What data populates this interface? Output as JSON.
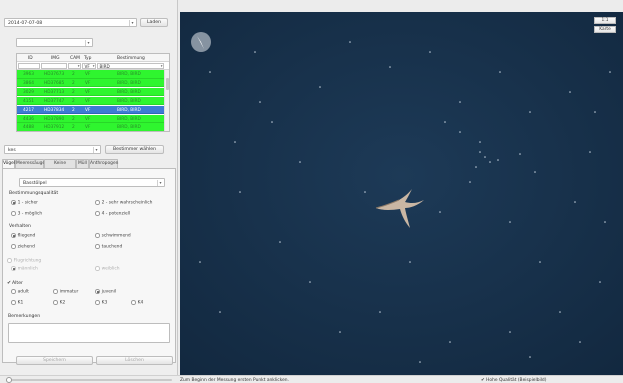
{
  "toolbar": {
    "date_value": "2014-07-07-08",
    "load_label": "Laden",
    "secondary_value": ""
  },
  "table": {
    "columns": [
      "ID",
      "IMG",
      "CAM",
      "Typ",
      "Bestimmung"
    ],
    "filter": {
      "typ": "VF",
      "bestimmung": "BIRD"
    },
    "rows": [
      {
        "id": "3963",
        "img": "HD37673",
        "cam": "2",
        "typ": "VF",
        "bestimmung": "BIRD, BIRD",
        "selected": false
      },
      {
        "id": "3864",
        "img": "HD37685",
        "cam": "2",
        "typ": "VF",
        "bestimmung": "BIRD, BIRD",
        "selected": false
      },
      {
        "id": "3029",
        "img": "HD37713",
        "cam": "2",
        "typ": "VF",
        "bestimmung": "BIRD, BIRD",
        "selected": false
      },
      {
        "id": "4151",
        "img": "HD37747",
        "cam": "2",
        "typ": "VF",
        "bestimmung": "BIRD, BIRD",
        "selected": false
      },
      {
        "id": "4217",
        "img": "HD37834",
        "cam": "2",
        "typ": "VF",
        "bestimmung": "BIRD, BIRD",
        "selected": true
      },
      {
        "id": "4436",
        "img": "HD37890",
        "cam": "2",
        "typ": "VF",
        "bestimmung": "BIRD, BIRD",
        "selected": false
      },
      {
        "id": "4488",
        "img": "HD37912",
        "cam": "2",
        "typ": "VF",
        "bestimmung": "BIRD, BIRD",
        "selected": false
      }
    ]
  },
  "identify": {
    "user_value": "kes",
    "choose_label": "Bestimmer wählen"
  },
  "tabs": [
    "Vögel",
    "Meeressäuger",
    "Keine Sichtung",
    "Müll",
    "Anthropogen"
  ],
  "form": {
    "species_value": "Basstölpel",
    "quality_heading": "Bestimmungsqualität",
    "quality_options": [
      "1 - sicher",
      "2 - sehr wahrscheinlich",
      "3 - möglich",
      "4 - potenziell"
    ],
    "behavior_heading": "Verhalten",
    "behavior_options": [
      "fliegend",
      "schwimmend",
      "ziehend",
      "tauchend"
    ],
    "direction_label": "Flugrichtung",
    "sex_options": [
      "männlich",
      "weiblich"
    ],
    "age_label": "Alter",
    "age_options": [
      "adult",
      "immatur",
      "juvenil",
      "K1",
      "K2",
      "K3",
      "K4"
    ],
    "remarks_label": "Bemerkungen",
    "save_label": "Speichern",
    "delete_label": "Löschen"
  },
  "map": {
    "zoom_label": "1:1",
    "map_label": "Karte"
  },
  "status": {
    "message": "Zum Beginn der Messung ersten Punkt anklicken.",
    "quality_check": "Hohe Qualität (Beispielbild)"
  },
  "colors": {
    "row_green": "#2ff52f",
    "row_selected": "#3d7bd4",
    "water": "#16304a"
  }
}
